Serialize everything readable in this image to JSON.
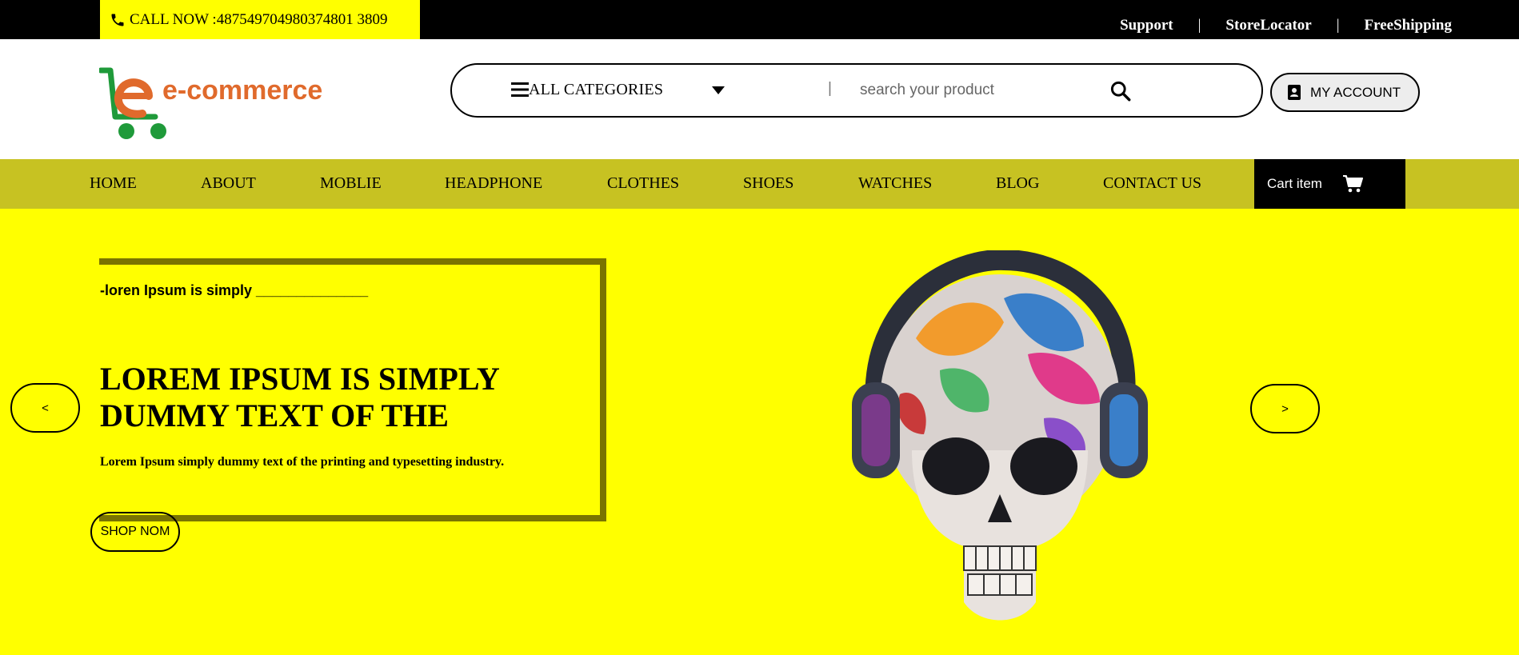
{
  "topbar": {
    "call_label": "CALL NOW :487549704980374801 3809",
    "links": [
      "Support",
      "StoreLocator",
      "FreeShipping"
    ],
    "separator": "|"
  },
  "header": {
    "logo_text": "e-commerce",
    "categories_label": "ALL CATEGORIES",
    "search_divider": "|",
    "search_placeholder": "search your product",
    "account_label": "MY ACCOUNT"
  },
  "nav": {
    "items": [
      "HOME",
      "ABOUT",
      "MOBLIE",
      "HEADPHONE",
      "CLOTHES",
      "SHOES",
      "WATCHES",
      "BLOG",
      "CONTACT US"
    ],
    "cart_label": "Cart item"
  },
  "hero": {
    "tagline": "-loren Ipsum is simply ______________",
    "headline": "LOREM IPSUM IS SIMPLY DUMMY TEXT OF THE",
    "subtext": "Lorem Ipsum simply dummy text of the printing and typesetting industry.",
    "shop_button": "SHOP NOM",
    "prev_label": "<",
    "next_label": ">"
  },
  "colors": {
    "topbar_bg": "#000000",
    "accent_yellow": "#ffff00",
    "nav_bg": "#c7c222",
    "frame_border": "#7a7400",
    "logo_orange": "#e06a2c",
    "logo_green": "#1f9a3a"
  },
  "icons": [
    "phone-icon",
    "menu-icon",
    "caret-down-icon",
    "search-icon",
    "account-icon",
    "cart-icon"
  ]
}
